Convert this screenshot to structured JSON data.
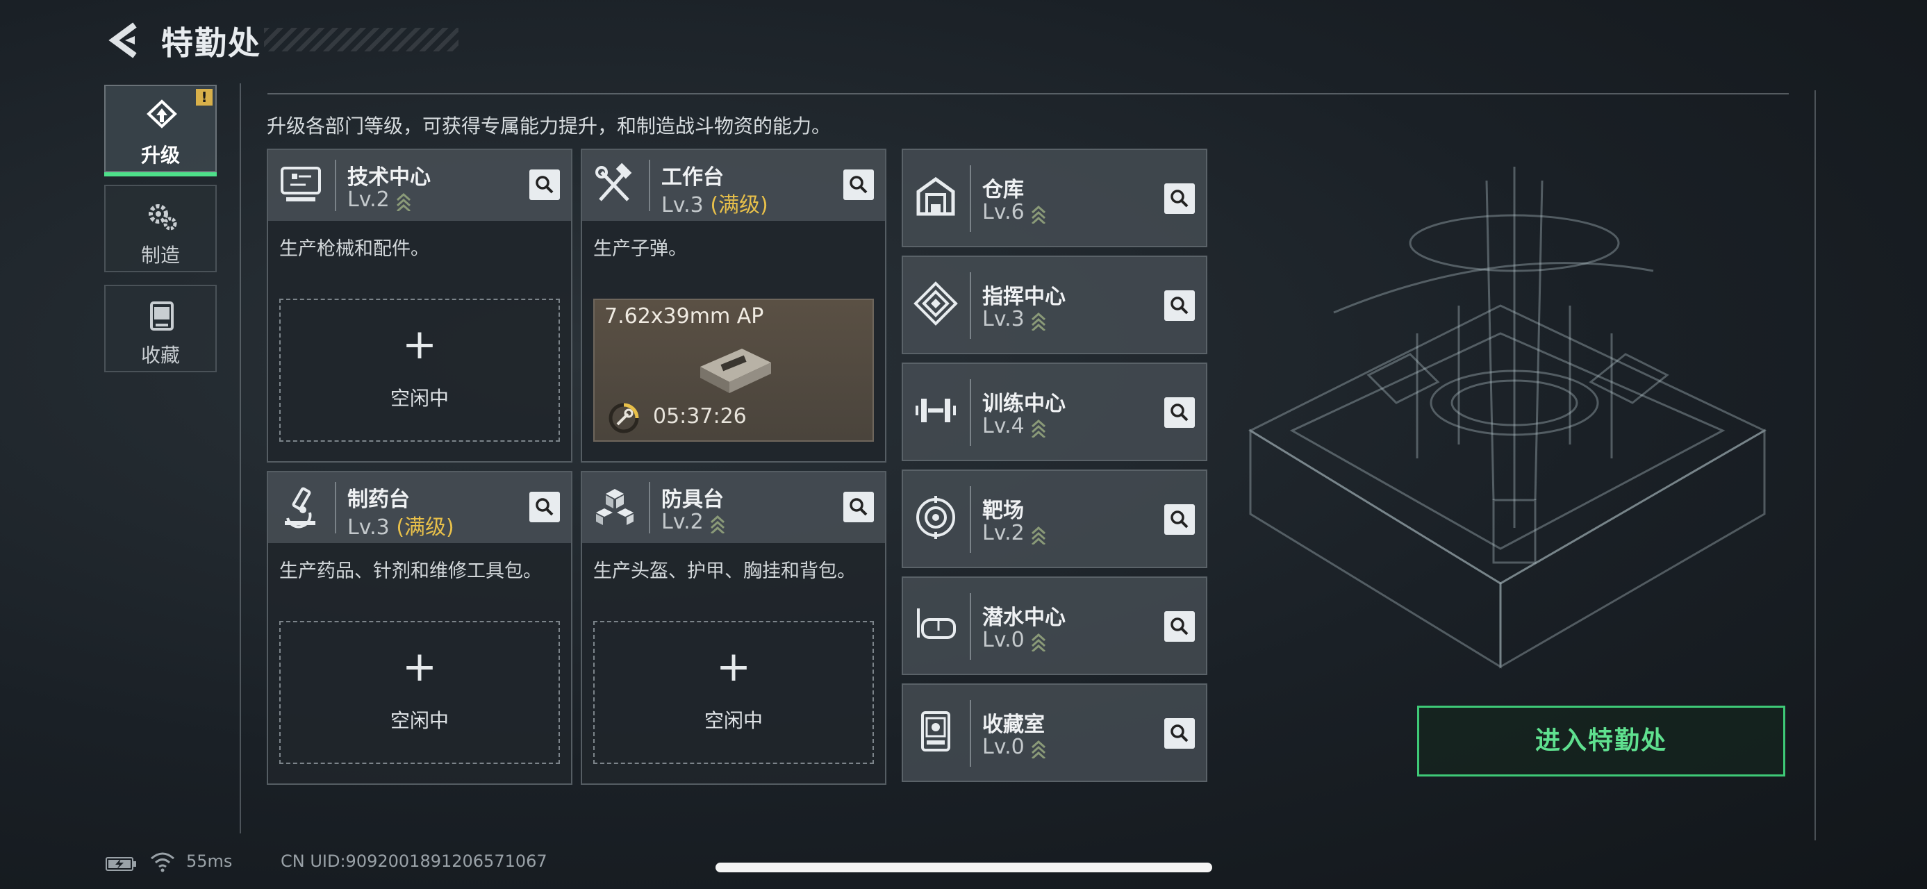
{
  "header": {
    "title": "特勤处"
  },
  "tabs": [
    {
      "label": "升级",
      "active": true,
      "icon": "upgrade-icon",
      "alert": "!"
    },
    {
      "label": "制造",
      "active": false,
      "icon": "gears-icon"
    },
    {
      "label": "收藏",
      "active": false,
      "icon": "collection-icon"
    }
  ],
  "description": "升级各部门等级，可获得专属能力提升，和制造战斗物资的能力。",
  "cards": [
    {
      "name": "技术中心",
      "level": "Lv.2",
      "max": "",
      "desc": "生产枪械和配件。",
      "slot": {
        "plus": "+",
        "status": "空闲中"
      }
    },
    {
      "name": "工作台",
      "level": "Lv.3",
      "max": "(满级)",
      "desc": "生产子弹。",
      "production": {
        "item": "7.62x39mm AP",
        "timer": "05:37:26"
      }
    },
    {
      "name": "制药台",
      "level": "Lv.3",
      "max": "(满级)",
      "desc": "生产药品、针剂和维修工具包。",
      "slot": {
        "plus": "+",
        "status": "空闲中"
      }
    },
    {
      "name": "防具台",
      "level": "Lv.2",
      "max": "",
      "desc": "生产头盔、护甲、胸挂和背包。",
      "slot": {
        "plus": "+",
        "status": "空闲中"
      }
    }
  ],
  "facilities": [
    {
      "name": "仓库",
      "level": "Lv.6",
      "icon": "warehouse-icon"
    },
    {
      "name": "指挥中心",
      "level": "Lv.3",
      "icon": "command-icon"
    },
    {
      "name": "训练中心",
      "level": "Lv.4",
      "icon": "dumbbell-icon"
    },
    {
      "name": "靶场",
      "level": "Lv.2",
      "icon": "target-icon"
    },
    {
      "name": "潜水中心",
      "level": "Lv.0",
      "icon": "diving-mask-icon"
    },
    {
      "name": "收藏室",
      "level": "Lv.0",
      "icon": "collection-room-icon"
    }
  ],
  "enter_button": "进入特勤处",
  "status": {
    "ping": "55ms",
    "uid": "CN UID:9092001891206571067"
  },
  "colors": {
    "accent_green": "#4ee08a",
    "max_level": "#e8c04a",
    "alert": "#d8b04a"
  }
}
